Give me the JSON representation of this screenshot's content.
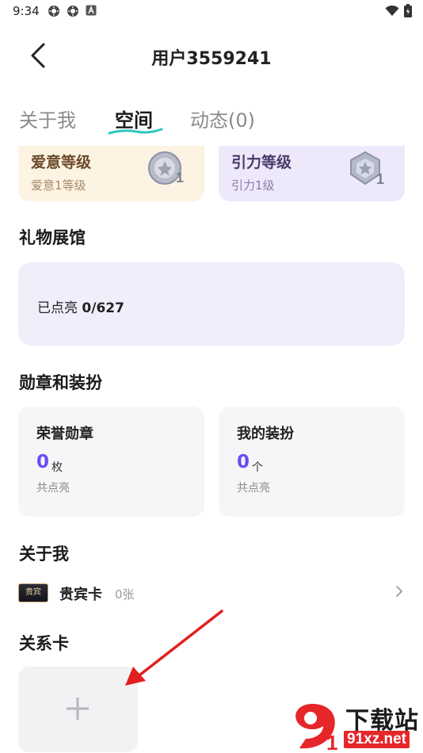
{
  "status_bar": {
    "time": "9:34",
    "left_icons": [
      "settings-gear-icon",
      "settings-gear-icon",
      "a-box-icon"
    ],
    "right_icons": [
      "wifi-icon",
      "battery-icon"
    ]
  },
  "nav": {
    "title": "用户3559241",
    "back_icon": "chevron-left-icon"
  },
  "tabs": [
    {
      "label": "关于我",
      "active": false
    },
    {
      "label": "空间",
      "active": true
    },
    {
      "label": "动态(0)",
      "active": false
    }
  ],
  "levels": [
    {
      "title": "爱意等级",
      "subtitle": "爱意1等级",
      "badge_number": "1",
      "bg": "#fdf3e3",
      "title_color": "#6b4a2a",
      "sub_color": "#a58a6a"
    },
    {
      "title": "引力等级",
      "subtitle": "引力1级",
      "badge_number": "1",
      "bg": "#ede9fb",
      "title_color": "#4a3a6a",
      "sub_color": "#8a7ca8"
    }
  ],
  "gift_section": {
    "title": "礼物展馆",
    "prefix": "已点亮 ",
    "value": "0/627"
  },
  "medal_section": {
    "title": "勋章和装扮",
    "cards": [
      {
        "title": "荣誉勋章",
        "count": "0",
        "unit": "枚",
        "sub": "共点亮"
      },
      {
        "title": "我的装扮",
        "count": "0",
        "unit": "个",
        "sub": "共点亮"
      }
    ]
  },
  "about_section": {
    "title": "关于我",
    "vip_icon_text": "贵宾",
    "vip_label": "贵宾卡",
    "vip_count": "0张"
  },
  "relation_section": {
    "title": "关系卡",
    "add_icon": "plus-icon"
  },
  "watermark": {
    "cn": "下载站",
    "url": "91xz.net",
    "logo_text": "9"
  },
  "colors": {
    "accent_purple": "#6a4cf5",
    "tab_underline": "#2ec7c0",
    "arrow_red": "#e0201f"
  }
}
